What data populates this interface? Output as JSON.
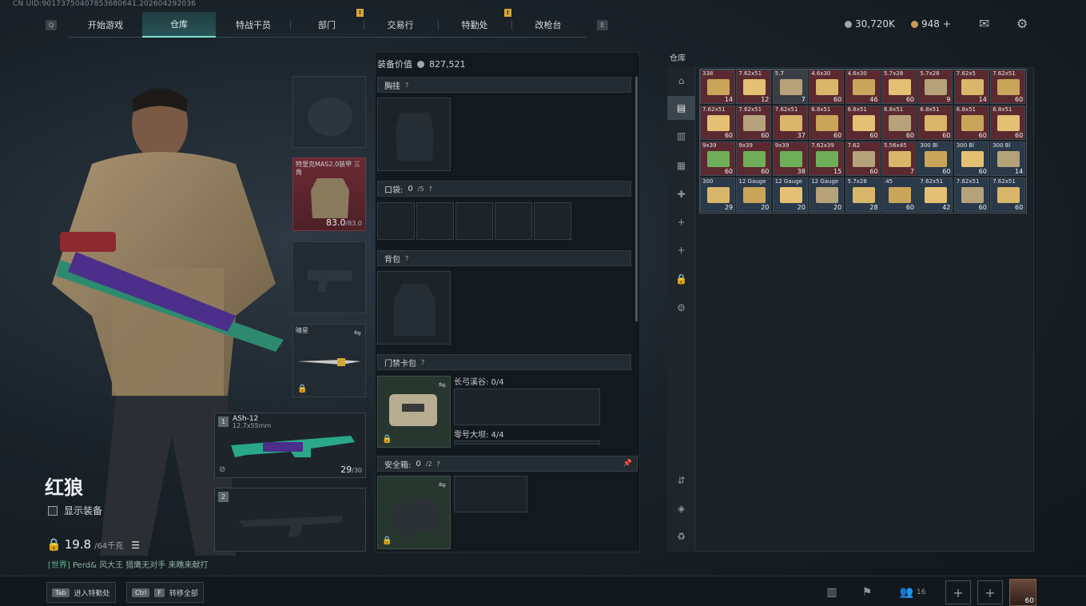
{
  "uid": "CN UID:90173750407853680641,202604292036",
  "nav": {
    "left_key": "Q",
    "right_key": "E",
    "tabs": [
      {
        "label": "开始游戏"
      },
      {
        "label": "仓库"
      },
      {
        "label": "特战干员"
      },
      {
        "label": "部门"
      },
      {
        "label": "交易行"
      },
      {
        "label": "特勤处"
      },
      {
        "label": "改枪台"
      }
    ],
    "notif_mark": "!"
  },
  "currency": {
    "silver": "30,720K",
    "gold": "948",
    "add": "+"
  },
  "character": {
    "name": "红狼",
    "show_equipment": "显示装备",
    "weight": "19.8",
    "weight_max": "/64千克"
  },
  "chat": {
    "channel": "[世界]",
    "text": "Perd& 风大王  猎鹰无对手 来瞧来献打"
  },
  "slots": {
    "armor_label": "特里克MAS2.0装甲 三角",
    "armor_value": "83.0",
    "armor_max": "/83.0",
    "melee_label": "晴星",
    "weapon1": {
      "num": "1",
      "name": "ASh-12",
      "cal": "12.7x55mm",
      "ammo": "29",
      "ammo_max": "/30"
    },
    "weapon2": {
      "num": "2"
    }
  },
  "mid": {
    "value_label": "装备价值",
    "value": "827,521",
    "chest": "胸挂",
    "pocket": "口袋:",
    "pocket_val": "0",
    "pocket_max": "/5",
    "backpack": "背包",
    "keycard": "门禁卡包",
    "key1_label": "长弓溪谷: 0/4",
    "key2_label": "零号大坝: 4/4",
    "safe": "安全箱:",
    "safe_val": "0",
    "safe_max": "/2",
    "qmark": "?"
  },
  "warehouse": {
    "title": "仓库",
    "side_add": "+",
    "items": [
      {
        "n": "338",
        "c": "14",
        "col": "#5a2a30"
      },
      {
        "n": "7.62x51",
        "c": "12",
        "col": "#5a2a30"
      },
      {
        "n": "5.7",
        "c": "7",
        "col": "#3a3e44"
      },
      {
        "n": "4.6x30",
        "c": "60",
        "col": "#5a2a30"
      },
      {
        "n": "4.6x30",
        "c": "46",
        "col": "#5a2a30"
      },
      {
        "n": "5.7x28",
        "c": "60",
        "col": "#5a2a30"
      },
      {
        "n": "5.7x28",
        "c": "9",
        "col": "#5a2a30"
      },
      {
        "n": "7.62x5",
        "c": "14",
        "col": "#5a2a30"
      },
      {
        "n": "7.62x51",
        "c": "60",
        "col": "#5a2a30"
      },
      {
        "n": "7.62x51",
        "c": "60",
        "col": "#5a2a30"
      },
      {
        "n": "7.62x51",
        "c": "60",
        "col": "#5a2a30"
      },
      {
        "n": "7.62x51",
        "c": "37",
        "col": "#5a2a30"
      },
      {
        "n": "6.8x51",
        "c": "60",
        "col": "#5a2a30"
      },
      {
        "n": "6.8x51",
        "c": "60",
        "col": "#5a2a30"
      },
      {
        "n": "6.8x51",
        "c": "60",
        "col": "#5a2a30"
      },
      {
        "n": "6.8x51",
        "c": "60",
        "col": "#5a2a30"
      },
      {
        "n": "6.8x51",
        "c": "60",
        "col": "#5a2a30"
      },
      {
        "n": "6.8x51",
        "c": "60",
        "col": "#5a2a30"
      },
      {
        "n": "9x39",
        "c": "60",
        "col": "#5a2a30"
      },
      {
        "n": "9x39",
        "c": "60",
        "col": "#5a2a30"
      },
      {
        "n": "9x39",
        "c": "38",
        "col": "#5a2a30"
      },
      {
        "n": "7.62x39",
        "c": "15",
        "col": "#5a2a30"
      },
      {
        "n": "7.62",
        "c": "60",
        "col": "#5a2a30"
      },
      {
        "n": "5.56x45",
        "c": "7",
        "col": "#5a2a30"
      },
      {
        "n": "300 Bl",
        "c": "60",
        "col": "#2a3a4a"
      },
      {
        "n": "300 Bl",
        "c": "60",
        "col": "#2a3a4a"
      },
      {
        "n": "300 Bl",
        "c": "14",
        "col": "#2a3a4a"
      },
      {
        "n": "300",
        "c": "29",
        "col": "#2a3a4a"
      },
      {
        "n": "12 Gauge",
        "c": "20",
        "col": "#2a3a4a"
      },
      {
        "n": "12 Gauge",
        "c": "20",
        "col": "#2a3a4a"
      },
      {
        "n": "12 Gauge",
        "c": "20",
        "col": "#2a3a4a"
      },
      {
        "n": "5.7x28",
        "c": "28",
        "col": "#2a3a4a"
      },
      {
        "n": ".45",
        "c": "60",
        "col": "#2a3a4a"
      },
      {
        "n": "7.62x51",
        "c": "42",
        "col": "#2a3a4a"
      },
      {
        "n": "7.62x51",
        "c": "60",
        "col": "#2a3a4a"
      },
      {
        "n": "7.62x51",
        "c": "60",
        "col": "#2a3a4a"
      }
    ]
  },
  "bottom": {
    "tab_key": "Tab",
    "tab_label": "进入特勤处",
    "ctrl_key": "Ctrl",
    "f_key": "F",
    "transfer_label": "转移全部",
    "friends": "16",
    "plus": "+",
    "level": "60"
  }
}
